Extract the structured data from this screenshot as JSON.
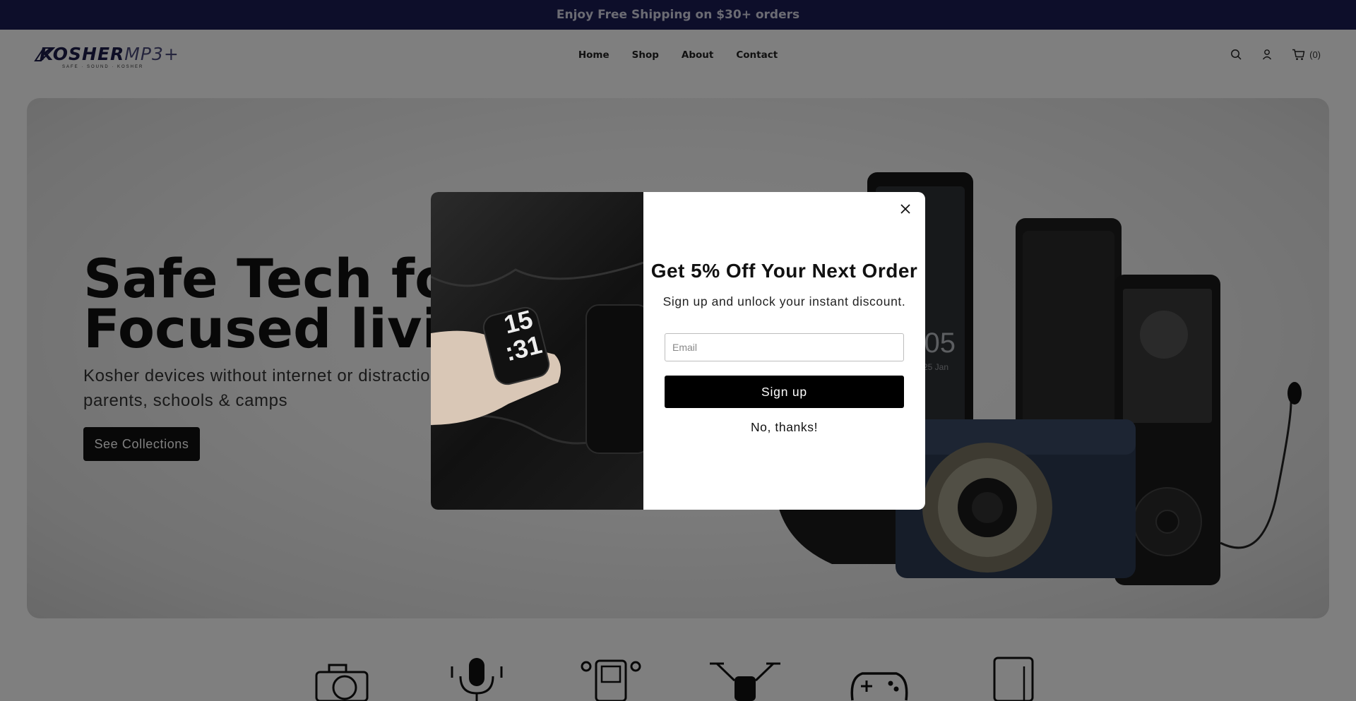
{
  "announcement": {
    "text": "Enjoy Free Shipping on $30+ orders"
  },
  "header": {
    "logo": {
      "brand": "KOSHER",
      "suffix": "MP3+",
      "tagline": "SAFE · SOUND · KOSHER"
    },
    "nav": [
      {
        "label": "Home"
      },
      {
        "label": "Shop"
      },
      {
        "label": "About"
      },
      {
        "label": "Contact"
      }
    ],
    "icons": [
      "search-icon",
      "account-icon",
      "cart-icon"
    ],
    "cart_count": "(0)"
  },
  "hero": {
    "title_line1": "Safe Tech for",
    "title_line2": "Focused living",
    "subtitle": "Kosher devices without internet or distractions for parents, schools & camps",
    "cta_label": "See Collections",
    "device_screen_time": "23:05",
    "device_screen_date": "Sunday 25 Jan"
  },
  "categories": [
    "camera-icon",
    "microphone-icon",
    "mp3-player-icon",
    "drone-icon",
    "gamepad-icon",
    "tablet-icon"
  ],
  "popup": {
    "image_watch_time": "15\n:31",
    "title": "Get 5% Off Your Next Order",
    "subtitle": "Sign up and unlock your instant discount.",
    "email_placeholder": "Email",
    "email_value": "",
    "signup_label": "Sign up",
    "decline_label": "No, thanks!"
  },
  "colors": {
    "announcement_bg": "#1b1d55",
    "overlay": "rgba(0,0,0,0.5)",
    "button_bg": "#111111"
  }
}
